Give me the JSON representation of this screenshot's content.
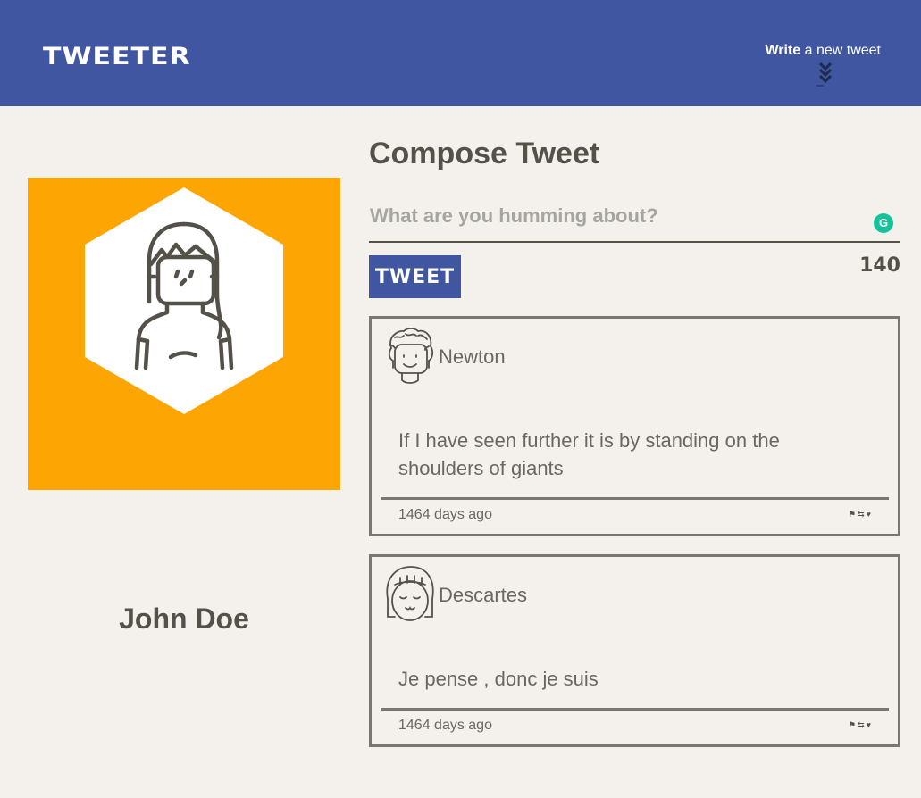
{
  "nav": {
    "brand": "Tweeter",
    "write_strong": "Write",
    "write_rest": " a new tweet",
    "toggle_icon": "double-chevron-down-icon",
    "color": "#4056a1"
  },
  "profile": {
    "name": "John Doe",
    "avatar_icon": "woman-avatar-icon",
    "bg_color": "#fda502"
  },
  "compose": {
    "title": "Compose Tweet",
    "placeholder": "What are you humming about?",
    "button_label": "Tweet",
    "counter": "140",
    "grammarly_icon": "grammarly-icon"
  },
  "tweets": [
    {
      "user": "Newton",
      "avatar_icon": "newton-avatar-icon",
      "content": "If I have seen further it is by standing on the shoulders of giants",
      "date": "1464 days ago",
      "actions": [
        "flag-icon",
        "retweet-icon",
        "heart-icon"
      ]
    },
    {
      "user": "Descartes",
      "avatar_icon": "descartes-avatar-icon",
      "content": "Je pense , donc je suis",
      "date": "1464 days ago",
      "actions": [
        "flag-icon",
        "retweet-icon",
        "heart-icon"
      ]
    }
  ]
}
